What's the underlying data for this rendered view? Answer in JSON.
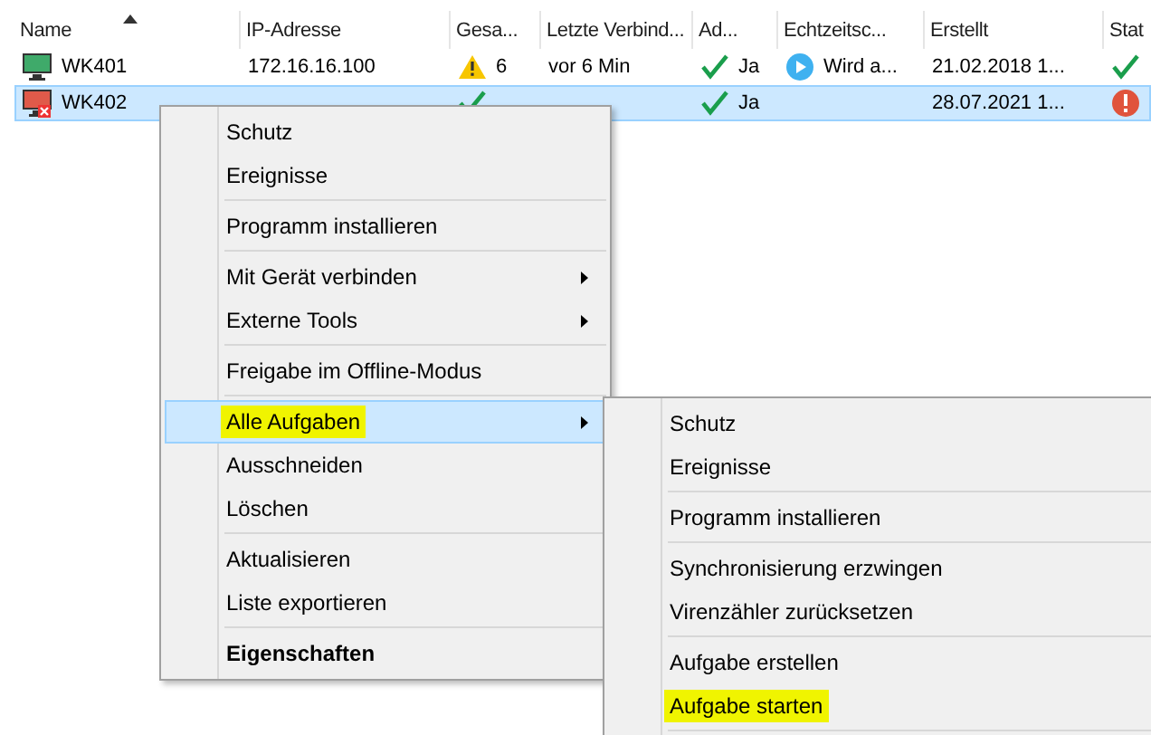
{
  "table": {
    "columns": [
      {
        "label": "Name",
        "sorted": true
      },
      {
        "label": "IP-Adresse"
      },
      {
        "label": "Gesa..."
      },
      {
        "label": "Letzte Verbind..."
      },
      {
        "label": "Ad..."
      },
      {
        "label": "Echtzeitsc..."
      },
      {
        "label": "Erstellt"
      },
      {
        "label": "Stat"
      }
    ],
    "rows": [
      {
        "selected": false,
        "online": true,
        "name": "WK401",
        "ip": "172.16.16.100",
        "warning": true,
        "count": "6",
        "last": "vor 6 Min",
        "admin_ok": true,
        "admin": "Ja",
        "realtime_running": true,
        "realtime_text": "Wird a...",
        "created": "21.02.2018 1...",
        "error": false
      },
      {
        "selected": true,
        "online": false,
        "name": "WK402",
        "warning": false,
        "admin_ok": true,
        "admin": "Ja",
        "realtime_running": false,
        "created": "28.07.2021 1...",
        "error": true
      }
    ]
  },
  "context_menu": {
    "items": [
      {
        "kind": "item",
        "label": "Schutz"
      },
      {
        "kind": "item",
        "label": "Ereignisse"
      },
      {
        "kind": "separator"
      },
      {
        "kind": "item",
        "label": "Programm installieren"
      },
      {
        "kind": "separator"
      },
      {
        "kind": "item",
        "label": "Mit Gerät verbinden",
        "submenu": true
      },
      {
        "kind": "item",
        "label": "Externe Tools",
        "submenu": true
      },
      {
        "kind": "separator"
      },
      {
        "kind": "item",
        "label": "Freigabe im Offline-Modus"
      },
      {
        "kind": "separator"
      },
      {
        "kind": "item",
        "label": "Alle Aufgaben",
        "submenu": true,
        "selected": true,
        "marked": true
      },
      {
        "kind": "item",
        "label": "Ausschneiden"
      },
      {
        "kind": "item",
        "label": "Löschen"
      },
      {
        "kind": "separator"
      },
      {
        "kind": "item",
        "label": "Aktualisieren"
      },
      {
        "kind": "item",
        "label": "Liste exportieren"
      },
      {
        "kind": "separator"
      },
      {
        "kind": "item",
        "label": "Eigenschaften",
        "default": true
      }
    ]
  },
  "submenu": {
    "items": [
      {
        "kind": "item",
        "label": "Schutz"
      },
      {
        "kind": "item",
        "label": "Ereignisse"
      },
      {
        "kind": "separator"
      },
      {
        "kind": "item",
        "label": "Programm installieren"
      },
      {
        "kind": "separator"
      },
      {
        "kind": "item",
        "label": "Synchronisierung erzwingen"
      },
      {
        "kind": "item",
        "label": "Virenzähler zurücksetzen"
      },
      {
        "kind": "separator"
      },
      {
        "kind": "item",
        "label": "Aufgabe erstellen"
      },
      {
        "kind": "item",
        "label": "Aufgabe starten",
        "marked": true
      },
      {
        "kind": "separator"
      }
    ]
  }
}
